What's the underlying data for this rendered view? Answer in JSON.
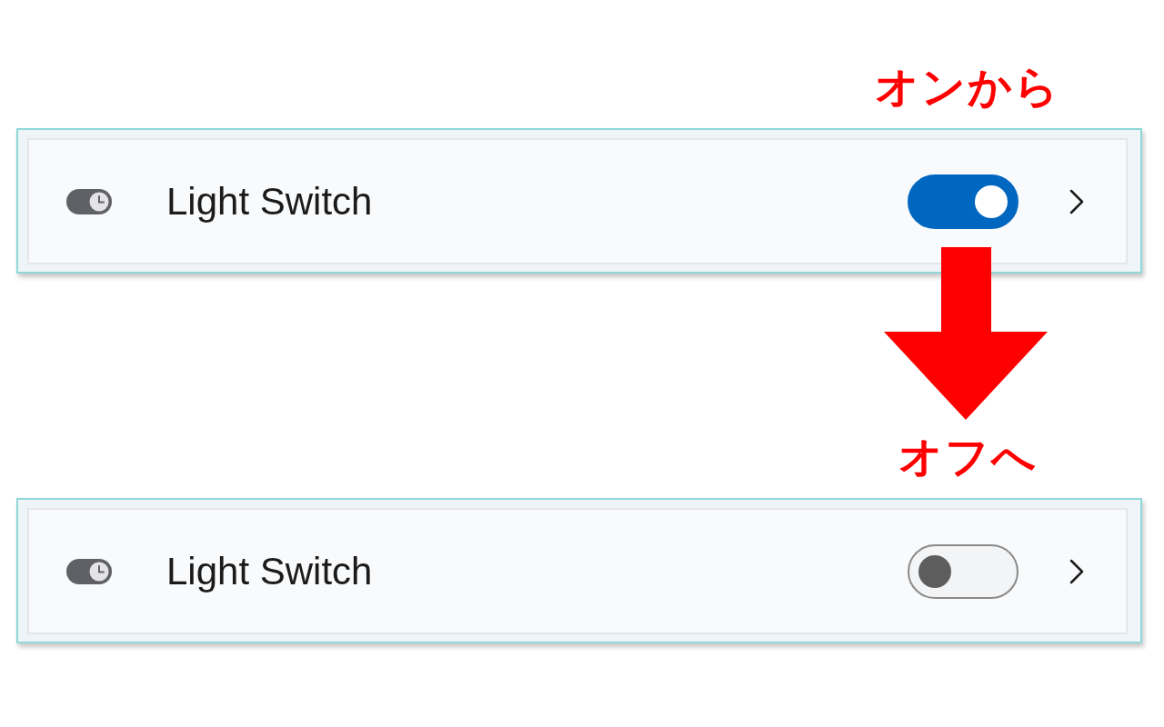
{
  "steps": [
    {
      "caption": "オンから",
      "setting": {
        "label": "Light Switch",
        "on": true
      }
    },
    {
      "caption": "オフへ",
      "setting": {
        "label": "Light Switch",
        "on": false
      }
    }
  ]
}
